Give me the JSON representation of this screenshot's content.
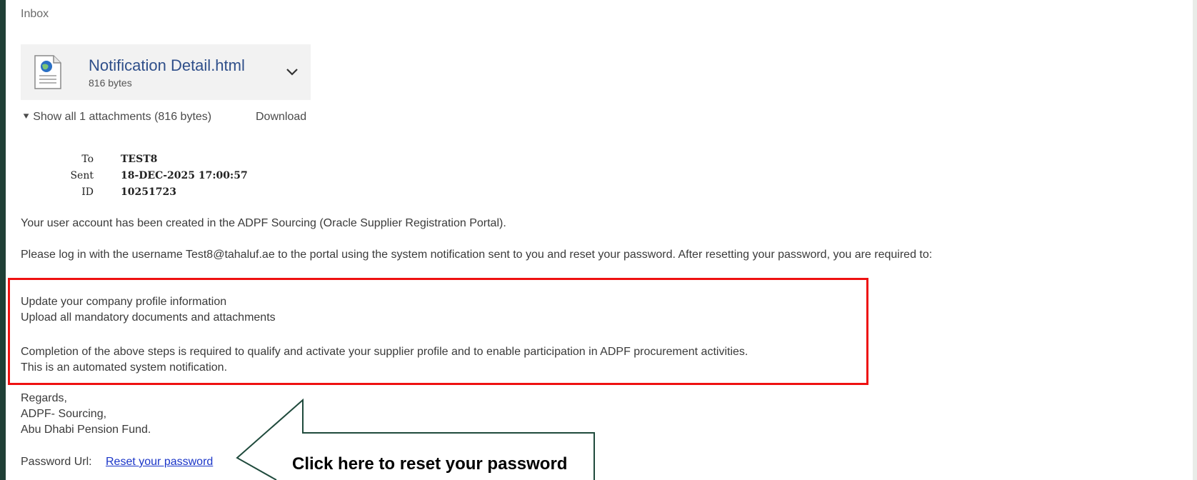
{
  "header": {
    "folder_label": "Inbox"
  },
  "attachment": {
    "file_name": "Notification Detail.html",
    "file_size": "816 bytes",
    "show_all_label": "Show all 1 attachments (816 bytes)",
    "download_label": "Download"
  },
  "meta": {
    "to_label": "To",
    "to_value": "TEST8",
    "sent_label": "Sent",
    "sent_value": "18-DEC-2025 17:00:57",
    "id_label": "ID",
    "id_value": "10251723"
  },
  "message": {
    "line1": "Your user account has been created in the ADPF Sourcing (Oracle Supplier Registration Portal).",
    "line2": "Please log in with the username Test8@tahaluf.ae to the portal using the system notification sent to you and reset your password. After resetting your password, you are required to:",
    "step1": "Update your company profile information",
    "step2": "Upload all mandatory documents and attachments",
    "completion": "Completion of the above steps is required to qualify and activate your supplier profile and to enable participation in ADPF procurement activities.",
    "automated": "This is an automated system notification.",
    "regards": "Regards,",
    "team": "ADPF- Sourcing,",
    "org": "Abu Dhabi Pension Fund.",
    "password_url_label": "Password Url:",
    "password_link": "Reset your password"
  },
  "annotation": {
    "callout_text": "Click here to reset your password",
    "highlight_color": "#ee1111",
    "callout_stroke_color": "#1f4a3c"
  },
  "icons": {
    "file": "html-file-icon",
    "chevron": "chevron-down-icon",
    "show_all": "double-chevron-down-icon"
  }
}
